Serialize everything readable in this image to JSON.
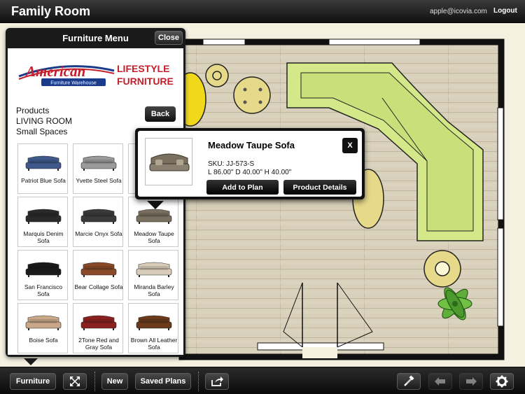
{
  "header": {
    "title": "Family Room",
    "email": "apple@icovia.com",
    "logout_label": "Logout"
  },
  "menu": {
    "title": "Furniture Menu",
    "close_label": "Close",
    "logo": {
      "brand": "American",
      "sub": "Furniture Warehouse",
      "line1": "LIFESTYLE",
      "line2": "FURNITURE"
    },
    "breadcrumb": [
      "Products",
      "LIVING ROOM",
      "Small Spaces"
    ],
    "back_label": "Back",
    "items": [
      {
        "name": "Patriot Blue Sofa",
        "color": "#3f5a8a"
      },
      {
        "name": "Yvette Steel Sofa",
        "color": "#9a9a9a"
      },
      {
        "name": "",
        "color": "#8a7a6a"
      },
      {
        "name": "Marquis Denim Sofa",
        "color": "#2a2a2a"
      },
      {
        "name": "Marcie Onyx Sofa",
        "color": "#3a3a3a"
      },
      {
        "name": "Meadow Taupe Sofa",
        "color": "#7a7060"
      },
      {
        "name": "San Francisco Sofa",
        "color": "#1a1a1a"
      },
      {
        "name": "Bear Collage Sofa",
        "color": "#8a4a2a"
      },
      {
        "name": "Miranda Barley Sofa",
        "color": "#d8ccb8"
      },
      {
        "name": "Boise Sofa",
        "color": "#c8a888"
      },
      {
        "name": "2Tone Red and Gray Sofa",
        "color": "#8a2020"
      },
      {
        "name": "Brown All Leather Sofa",
        "color": "#6a3a1a"
      }
    ]
  },
  "popup": {
    "title": "Meadow Taupe Sofa",
    "close_label": "X",
    "sku": "SKU: JJ-573-S",
    "dims": "L 86.00\" D 40.00\" H 40.00\"",
    "add_label": "Add to Plan",
    "details_label": "Product Details"
  },
  "toolbar": {
    "furniture_label": "Furniture",
    "new_label": "New",
    "saved_label": "Saved Plans"
  },
  "colors": {
    "sofa_green": "#d4e88a",
    "table_yellow": "#e6d98a",
    "floor": "#d9d1bb"
  }
}
